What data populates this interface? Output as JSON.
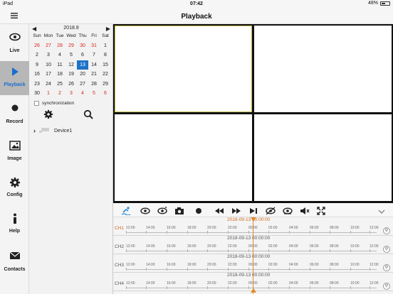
{
  "status": {
    "device": "iPad",
    "time": "07:42",
    "battery": "48%"
  },
  "header": {
    "title": "Playback",
    "menu_icon": "menu-icon"
  },
  "sidebar": {
    "items": [
      {
        "label": "Live",
        "icon": "eye-icon"
      },
      {
        "label": "Playback",
        "icon": "play-icon",
        "active": true
      },
      {
        "label": "Record",
        "icon": "record-dot-icon"
      },
      {
        "label": "Image",
        "icon": "image-icon"
      },
      {
        "label": "Config",
        "icon": "gear-icon"
      },
      {
        "label": "Help",
        "icon": "info-icon"
      },
      {
        "label": "Contacts",
        "icon": "envelope-icon"
      }
    ]
  },
  "calendar": {
    "month": "2018.9",
    "weekdays": [
      "Sun",
      "Mon",
      "Tue",
      "Wed",
      "Thu",
      "Fri",
      "Sat"
    ],
    "weeks": [
      [
        "26",
        "27",
        "28",
        "29",
        "30",
        "31",
        "1"
      ],
      [
        "2",
        "3",
        "4",
        "5",
        "6",
        "7",
        "8"
      ],
      [
        "9",
        "10",
        "11",
        "12",
        "13",
        "14",
        "15"
      ],
      [
        "16",
        "17",
        "18",
        "19",
        "20",
        "21",
        "22"
      ],
      [
        "23",
        "24",
        "25",
        "26",
        "27",
        "28",
        "29"
      ],
      [
        "30",
        "1",
        "2",
        "3",
        "4",
        "5",
        "6"
      ]
    ],
    "selected": "13"
  },
  "panel": {
    "sync_label": "synchronization",
    "device_name": "Device1"
  },
  "timeline": {
    "channels": [
      {
        "label": "CH1",
        "date": "2018-09-13  00:00:00"
      },
      {
        "label": "CH2",
        "date": "2018-09-13  00:00:00"
      },
      {
        "label": "CH3",
        "date": "2018-09-13  00:00:00"
      },
      {
        "label": "CH4",
        "date": "2018-09-13  00:00:00"
      }
    ],
    "ticks": [
      "12:00",
      "14:00",
      "16:00",
      "18:00",
      "20:00",
      "22:00",
      "00:00",
      "02:00",
      "04:00",
      "06:00",
      "08:00",
      "10:00",
      "12:00"
    ]
  },
  "colors": {
    "accent": "#1a6fd0",
    "selected_frame": "#c8bd49",
    "cursor": "#e08a2a"
  }
}
